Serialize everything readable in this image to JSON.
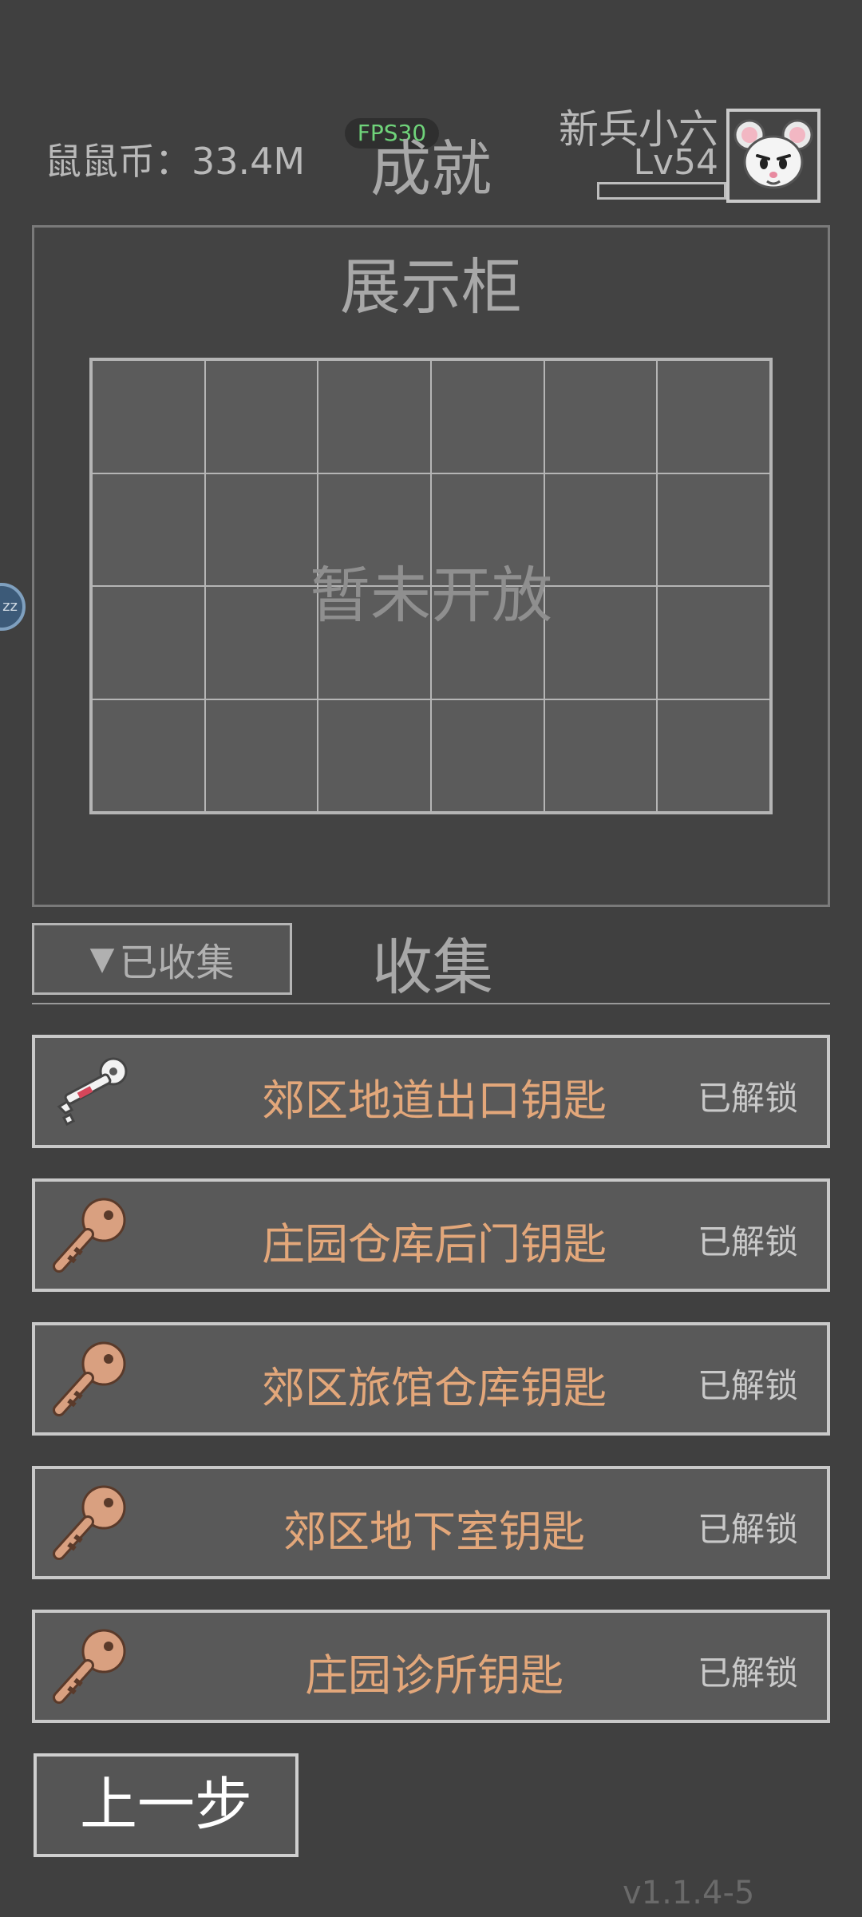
{
  "header": {
    "coins_label": "鼠鼠币：33.4M",
    "fps_label": "FPS30",
    "title": "成就",
    "player_name": "新兵小六",
    "player_level": "Lv54"
  },
  "showcase": {
    "title": "展示柜",
    "overlay_text": "暂未开放",
    "grid_rows": 4,
    "grid_cols": 6
  },
  "collection": {
    "filter_label": "已收集",
    "section_title": "收集",
    "items": [
      {
        "name": "郊区地道出口钥匙",
        "status": "已解锁",
        "icon": "white-key-icon"
      },
      {
        "name": "庄园仓库后门钥匙",
        "status": "已解锁",
        "icon": "bronze-key-icon"
      },
      {
        "name": "郊区旅馆仓库钥匙",
        "status": "已解锁",
        "icon": "bronze-key-icon"
      },
      {
        "name": "郊区地下室钥匙",
        "status": "已解锁",
        "icon": "bronze-key-icon"
      },
      {
        "name": "庄园诊所钥匙",
        "status": "已解锁",
        "icon": "bronze-key-icon"
      }
    ]
  },
  "footer": {
    "back_label": "上一步",
    "version": "v1.1.4-5"
  },
  "colors": {
    "background": "#404040",
    "item_text": "#e3a77a",
    "fps_text": "#6fd37a"
  }
}
